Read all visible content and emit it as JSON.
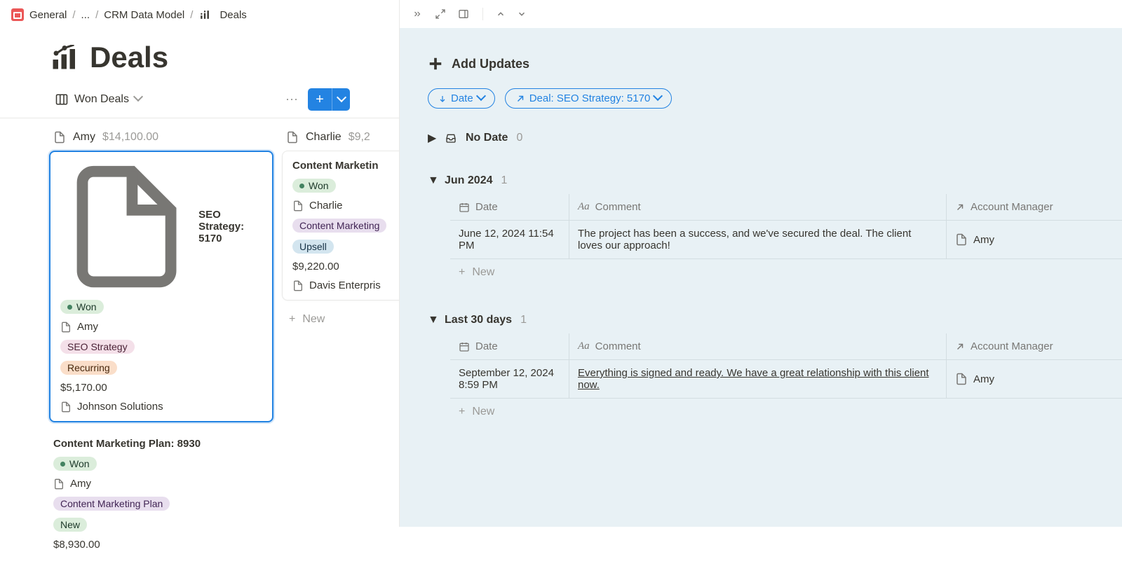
{
  "breadcrumbs": {
    "root": "General",
    "ellipsis": "...",
    "parent": "CRM Data Model",
    "current": "Deals"
  },
  "page_title": "Deals",
  "view": {
    "name": "Won Deals"
  },
  "board": {
    "columns": [
      {
        "name": "Amy",
        "total": "$14,100.00",
        "cards": [
          {
            "title": "SEO Strategy: 5170",
            "selected": true,
            "status": "Won",
            "owner": "Amy",
            "tags": [
              {
                "text": "SEO Strategy",
                "cls": "seostrat"
              },
              {
                "text": "Recurring",
                "cls": "recurring"
              }
            ],
            "amount": "$5,170.00",
            "company": "Johnson Solutions"
          },
          {
            "title": "Content Marketing Plan: 8930",
            "selected": false,
            "status": "Won",
            "owner": "Amy",
            "tags": [
              {
                "text": "Content Marketing Plan",
                "cls": "contentmkt"
              },
              {
                "text": "New",
                "cls": "new"
              }
            ],
            "amount": "$8,930.00",
            "company": ""
          }
        ]
      },
      {
        "name": "Charlie",
        "total": "$9,2",
        "cards": [
          {
            "title": "Content Marketin",
            "selected": false,
            "status": "Won",
            "owner": "Charlie",
            "tags": [
              {
                "text": "Content Marketing",
                "cls": "contentmkt"
              },
              {
                "text": "Upsell",
                "cls": "upsell"
              }
            ],
            "amount": "$9,220.00",
            "company": "Davis Enterpris"
          }
        ],
        "add_label": "New"
      }
    ]
  },
  "right_panel": {
    "add_updates": "Add Updates",
    "pill_date": "Date",
    "pill_deal": "Deal: SEO Strategy: 5170",
    "groups": [
      {
        "collapsed": true,
        "icon": "tray",
        "label": "No Date",
        "count": "0"
      },
      {
        "collapsed": false,
        "label": "Jun 2024",
        "count": "1",
        "columns": {
          "date": "Date",
          "comment": "Comment",
          "manager": "Account Manager"
        },
        "rows": [
          {
            "date": "June 12, 2024 11:54 PM",
            "comment": "The project has been a success, and we've secured the deal. The client loves our approach!",
            "manager": "Amy"
          }
        ],
        "add_label": "New"
      },
      {
        "collapsed": false,
        "label": "Last 30 days",
        "count": "1",
        "columns": {
          "date": "Date",
          "comment": "Comment",
          "manager": "Account Manager"
        },
        "rows": [
          {
            "date": "September 12, 2024 8:59 PM",
            "comment": "Everything is signed and ready. We have a great relationship with this client now.",
            "manager": "Amy"
          }
        ],
        "add_label": "New"
      }
    ]
  }
}
